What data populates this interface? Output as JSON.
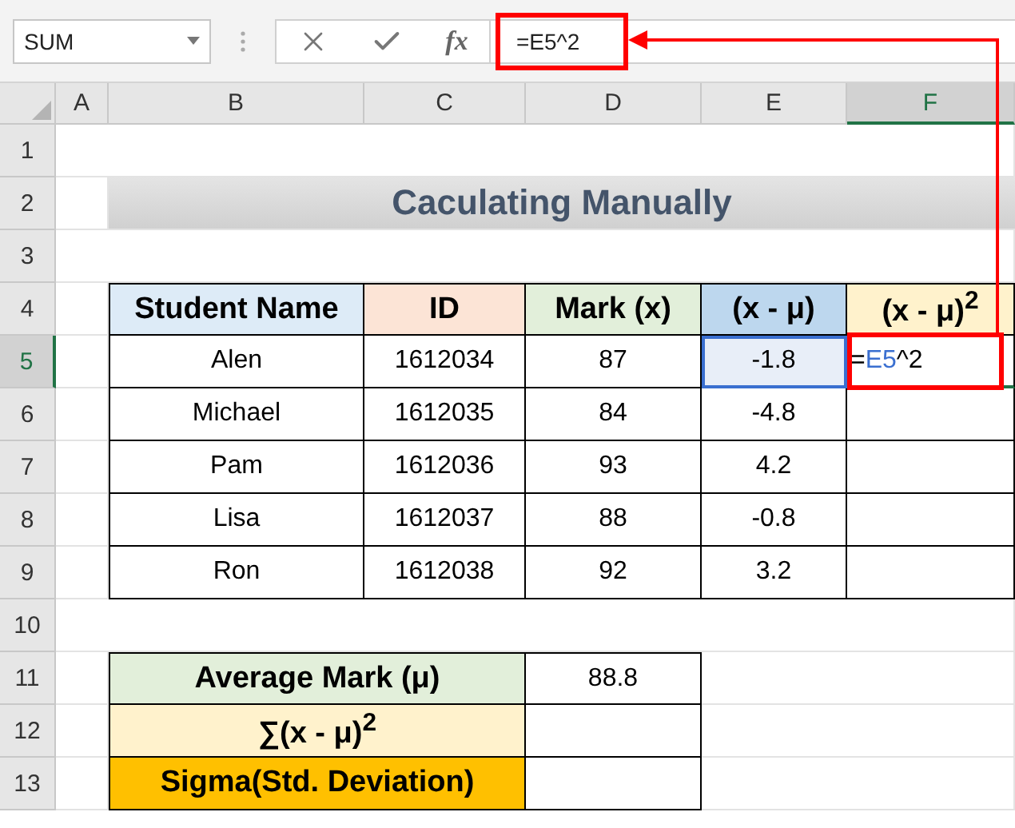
{
  "name_box": {
    "value": "SUM"
  },
  "formula_bar": {
    "function_label": "fx",
    "value": "=E5^2"
  },
  "column_headers": [
    {
      "label": "A",
      "selected": false
    },
    {
      "label": "B",
      "selected": false
    },
    {
      "label": "C",
      "selected": false
    },
    {
      "label": "D",
      "selected": false
    },
    {
      "label": "E",
      "selected": false
    },
    {
      "label": "F",
      "selected": true
    }
  ],
  "row_headers": [
    {
      "label": "1",
      "selected": false
    },
    {
      "label": "2",
      "selected": false
    },
    {
      "label": "3",
      "selected": false
    },
    {
      "label": "4",
      "selected": false
    },
    {
      "label": "5",
      "selected": true
    },
    {
      "label": "6",
      "selected": false
    },
    {
      "label": "7",
      "selected": false
    },
    {
      "label": "8",
      "selected": false
    },
    {
      "label": "9",
      "selected": false
    },
    {
      "label": "10",
      "selected": false
    },
    {
      "label": "11",
      "selected": false
    },
    {
      "label": "12",
      "selected": false
    },
    {
      "label": "13",
      "selected": false
    }
  ],
  "title": "Caculating Manually",
  "table": {
    "columns": [
      {
        "label": "Student Name",
        "color": "#ddebf7"
      },
      {
        "label": "ID",
        "color": "#fce4d6"
      },
      {
        "label": "Mark (x)",
        "color": "#e2efda"
      },
      {
        "label": "(x - μ)",
        "color": "#bdd7ee"
      },
      {
        "label": "(x - μ)$^{2}$",
        "color": "#fff2cc"
      }
    ],
    "rows": [
      {
        "cells": [
          "Alen",
          "1612034",
          "87",
          "-1.8"
        ],
        "editing": [
          {
            "kind": "plain",
            "text": "="
          },
          {
            "kind": "ref",
            "text": "E5"
          },
          {
            "kind": "plain",
            "text": "^2"
          }
        ]
      },
      {
        "cells": [
          "Michael",
          "1612035",
          "84",
          "-4.8"
        ]
      },
      {
        "cells": [
          "Pam",
          "1612036",
          "93",
          "4.2"
        ]
      },
      {
        "cells": [
          "Lisa",
          "1612037",
          "88",
          "-0.8"
        ]
      },
      {
        "cells": [
          "Ron",
          "1612038",
          "92",
          "3.2"
        ]
      }
    ]
  },
  "summary": [
    {
      "label": "Average Mark (μ)",
      "value": "88.8",
      "color": "#e2efda"
    },
    {
      "label": "∑(x - μ)$^{2}$",
      "color": "#fff2cc"
    },
    {
      "label": "Sigma(Std. Deviation)",
      "color": "#ffc000"
    }
  ]
}
